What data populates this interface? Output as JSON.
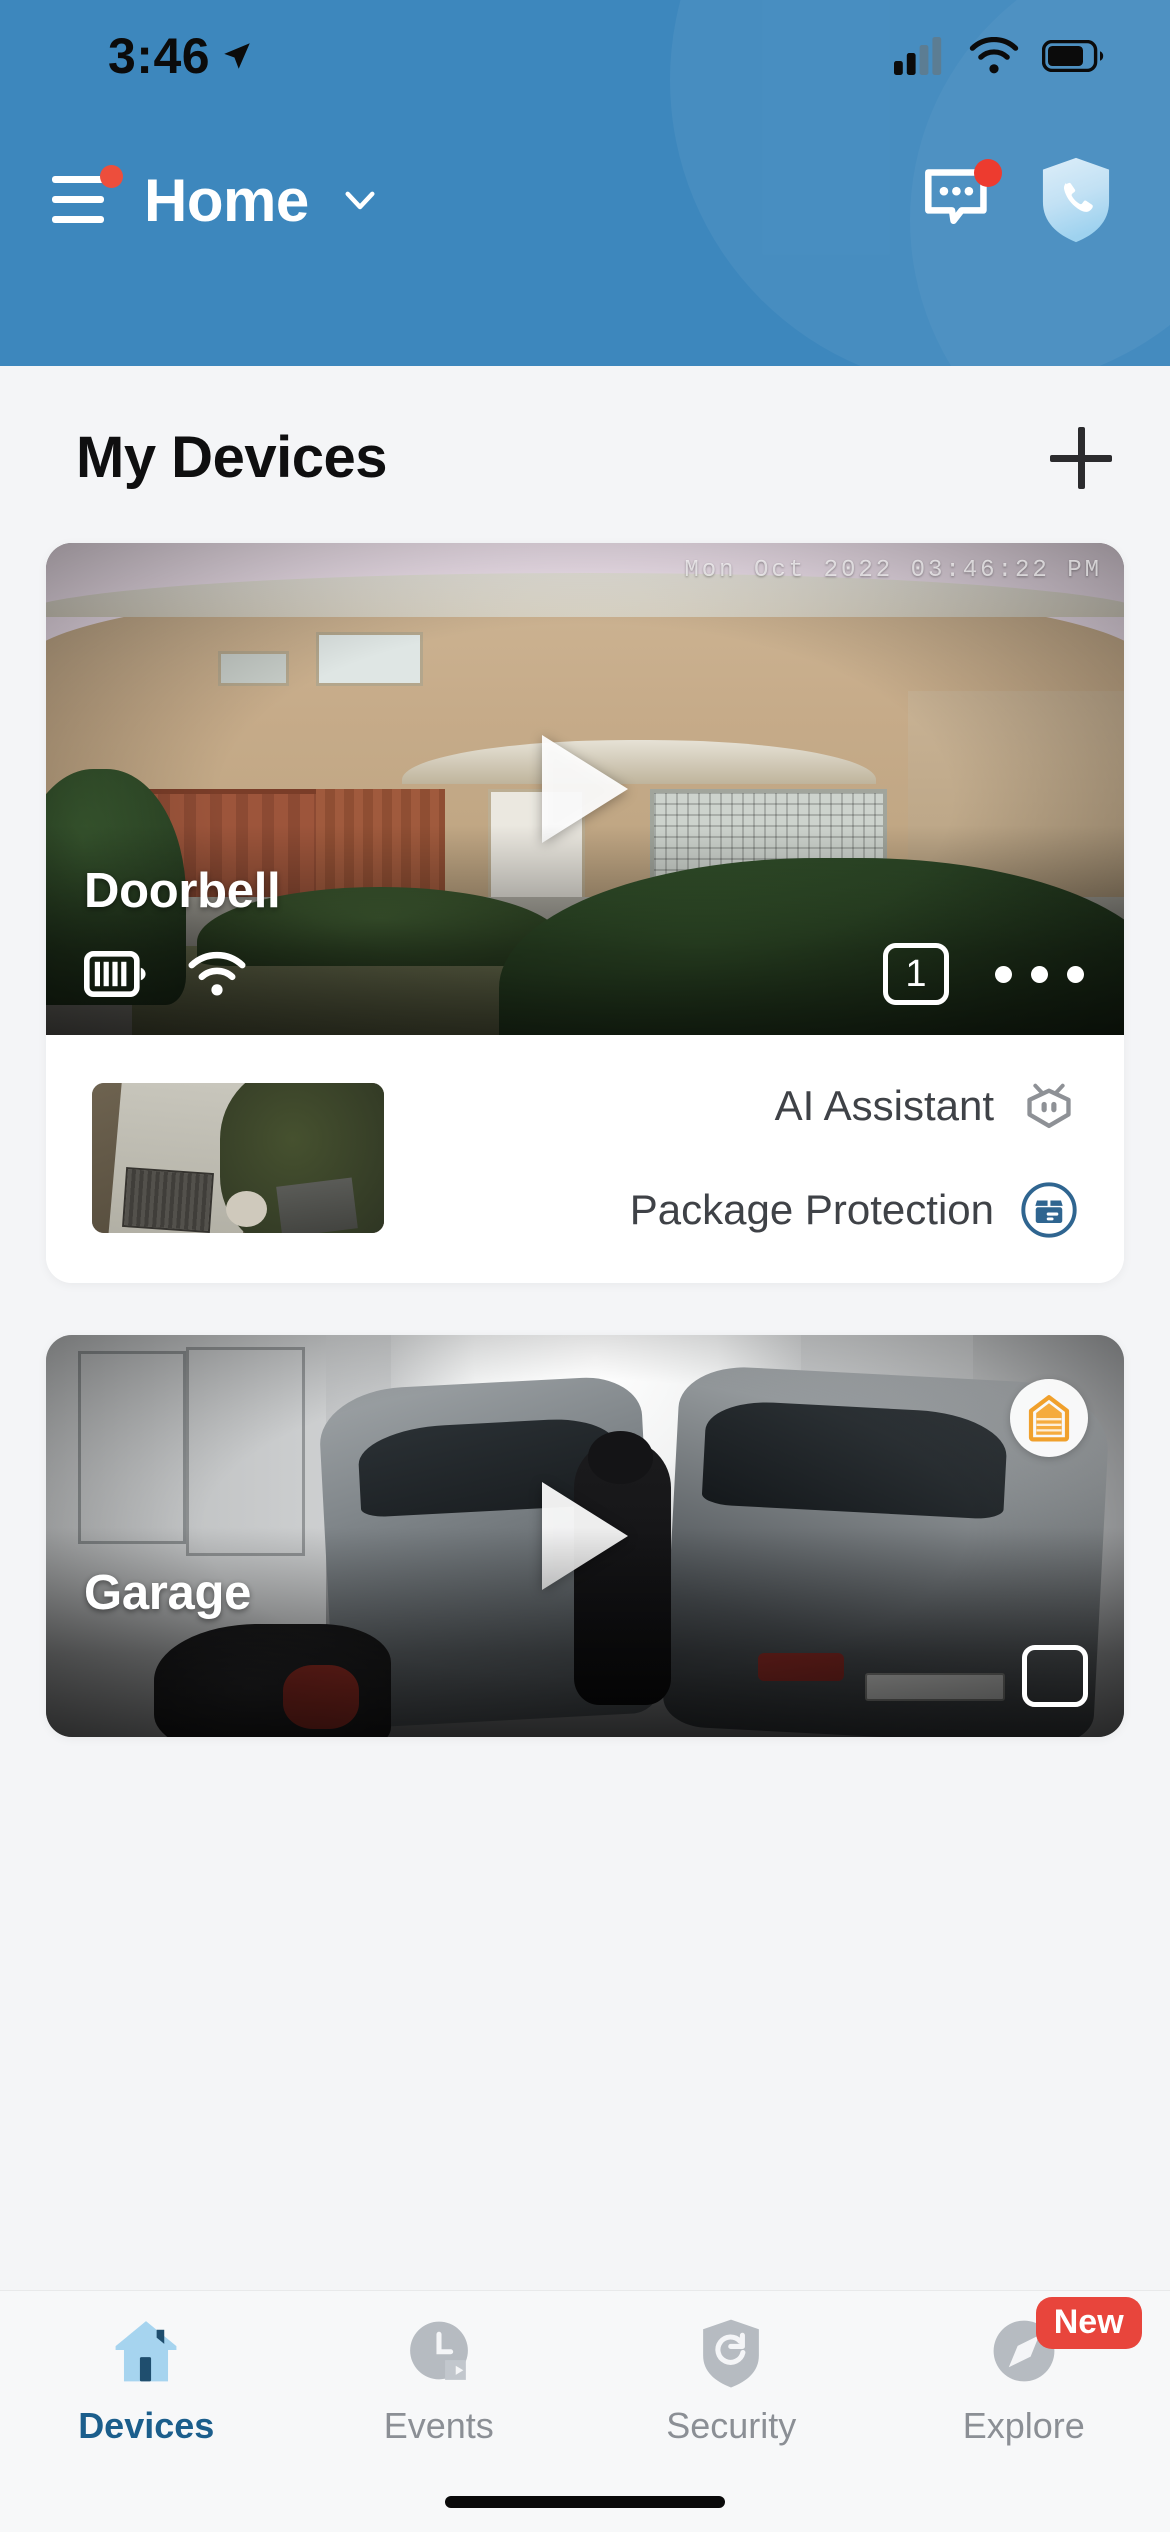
{
  "status_bar": {
    "time": "3:46",
    "location_icon": "location-arrow-icon",
    "cellular_icon": "cellular-signal-icon",
    "wifi_icon": "wifi-icon",
    "battery_icon": "battery-icon"
  },
  "header": {
    "menu_icon": "hamburger-menu-icon",
    "menu_has_badge": true,
    "title": "Home",
    "chevron_icon": "chevron-down-icon",
    "chat_icon": "chat-bubble-icon",
    "chat_has_badge": true,
    "emergency_icon": "shield-phone-icon",
    "background_color": "#3d87bd"
  },
  "section": {
    "title": "My Devices",
    "add_icon": "plus-icon"
  },
  "devices": [
    {
      "name": "Doorbell",
      "timestamp_overlay": "Mon Oct 2022  03:46:22 PM",
      "play_icon": "play-icon",
      "battery_icon": "battery-full-icon",
      "wifi_icon": "wifi-icon",
      "count_badge": "1",
      "more_icon": "more-horizontal-icon"
    },
    {
      "name": "Garage",
      "play_icon": "play-icon",
      "garage_icon": "garage-door-icon"
    }
  ],
  "features": {
    "thumbnail_name": "event-thumbnail",
    "items": [
      {
        "label": "AI Assistant",
        "icon": "ai-robot-icon",
        "color": "#8e9196"
      },
      {
        "label": "Package Protection",
        "icon": "package-box-icon",
        "color": "#2f6590"
      }
    ]
  },
  "tabbar": {
    "tabs": [
      {
        "label": "Devices",
        "icon": "home-icon",
        "active": true
      },
      {
        "label": "Events",
        "icon": "clock-video-icon",
        "active": false
      },
      {
        "label": "Security",
        "icon": "shield-icon",
        "active": false
      },
      {
        "label": "Explore",
        "icon": "compass-icon",
        "active": false,
        "badge": "New"
      }
    ],
    "active_color": "#1b5e8c",
    "inactive_color": "#8b8f95",
    "badge_color": "#e8453c"
  }
}
